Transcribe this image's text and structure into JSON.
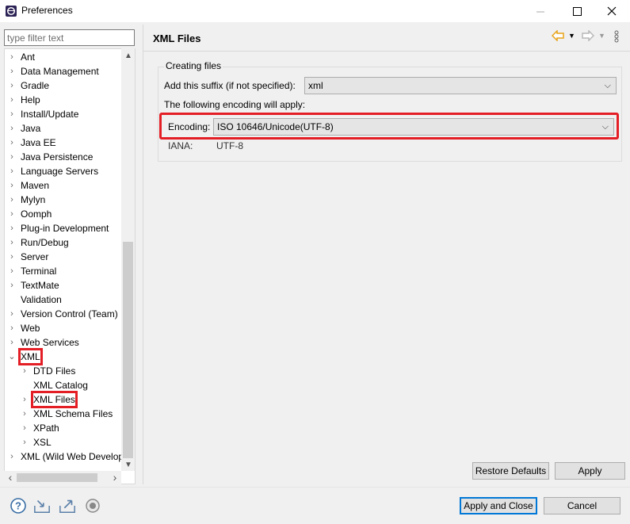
{
  "window": {
    "title": "Preferences",
    "minimize": "—",
    "maximize": "☐",
    "close": "✕"
  },
  "filter": {
    "placeholder": "type filter text"
  },
  "tree": {
    "items": [
      {
        "label": "Ant",
        "twisty": "›",
        "level": 0
      },
      {
        "label": "Data Management",
        "twisty": "›",
        "level": 0
      },
      {
        "label": "Gradle",
        "twisty": "›",
        "level": 0
      },
      {
        "label": "Help",
        "twisty": "›",
        "level": 0
      },
      {
        "label": "Install/Update",
        "twisty": "›",
        "level": 0
      },
      {
        "label": "Java",
        "twisty": "›",
        "level": 0
      },
      {
        "label": "Java EE",
        "twisty": "›",
        "level": 0
      },
      {
        "label": "Java Persistence",
        "twisty": "›",
        "level": 0
      },
      {
        "label": "Language Servers",
        "twisty": "›",
        "level": 0
      },
      {
        "label": "Maven",
        "twisty": "›",
        "level": 0
      },
      {
        "label": "Mylyn",
        "twisty": "›",
        "level": 0
      },
      {
        "label": "Oomph",
        "twisty": "›",
        "level": 0
      },
      {
        "label": "Plug-in Development",
        "twisty": "›",
        "level": 0
      },
      {
        "label": "Run/Debug",
        "twisty": "›",
        "level": 0
      },
      {
        "label": "Server",
        "twisty": "›",
        "level": 0
      },
      {
        "label": "Terminal",
        "twisty": "›",
        "level": 0
      },
      {
        "label": "TextMate",
        "twisty": "›",
        "level": 0
      },
      {
        "label": "Validation",
        "twisty": "",
        "level": 0
      },
      {
        "label": "Version Control (Team)",
        "twisty": "›",
        "level": 0
      },
      {
        "label": "Web",
        "twisty": "›",
        "level": 0
      },
      {
        "label": "Web Services",
        "twisty": "›",
        "level": 0
      },
      {
        "label": "XML",
        "twisty": "⌄",
        "level": 0,
        "highlight": true
      },
      {
        "label": "DTD Files",
        "twisty": "›",
        "level": 1
      },
      {
        "label": "XML Catalog",
        "twisty": "",
        "level": 1
      },
      {
        "label": "XML Files",
        "twisty": "›",
        "level": 1,
        "highlight": true
      },
      {
        "label": "XML Schema Files",
        "twisty": "›",
        "level": 1
      },
      {
        "label": "XPath",
        "twisty": "›",
        "level": 1
      },
      {
        "label": "XSL",
        "twisty": "›",
        "level": 1
      },
      {
        "label": "XML (Wild Web Developer)",
        "twisty": "›",
        "level": 0
      }
    ]
  },
  "page": {
    "title": "XML Files",
    "group_label": "Creating files",
    "suffix_label": "Add this suffix (if not specified):",
    "suffix_value": "xml",
    "encoding_info": "The following encoding will apply:",
    "encoding_label": "Encoding:",
    "encoding_value": "ISO 10646/Unicode(UTF-8)",
    "iana_label": "IANA:",
    "iana_value": "UTF-8",
    "restore_defaults": "Restore Defaults",
    "apply": "Apply"
  },
  "footer": {
    "apply_close": "Apply and Close",
    "cancel": "Cancel"
  },
  "colors": {
    "highlight": "#e41e25",
    "nav_arrow": "#e8a317",
    "default_button": "#0078d7"
  }
}
